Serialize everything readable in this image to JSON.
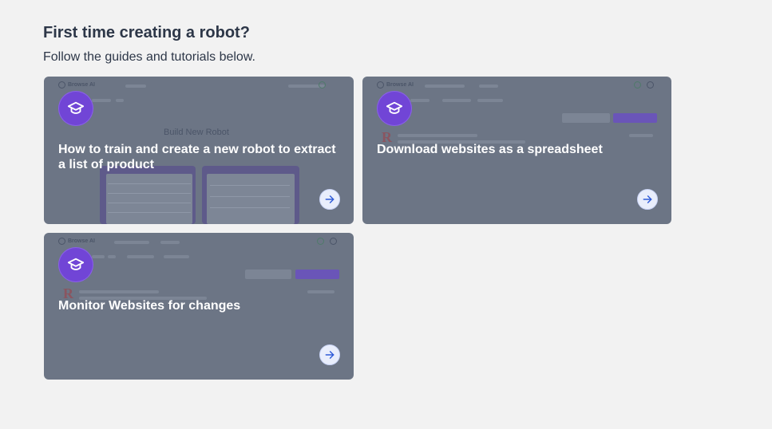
{
  "intro": {
    "title": "First time creating a robot?",
    "subtitle": "Follow the guides and tutorials below."
  },
  "cards": [
    {
      "title": "How to train and create a new robot to extract a list of product",
      "preview_brand": "Browse AI",
      "preview_heading": "Build New Robot",
      "badge_icon": "graduation-cap-icon",
      "action_icon": "arrow-right-icon"
    },
    {
      "title": "Download websites as a spreadsheet",
      "preview_brand": "Browse AI",
      "badge_icon": "graduation-cap-icon",
      "action_icon": "arrow-right-icon"
    },
    {
      "title": "Monitor Websites for changes",
      "preview_brand": "Browse AI",
      "badge_icon": "graduation-cap-icon",
      "action_icon": "arrow-right-icon"
    }
  ],
  "colors": {
    "page_bg": "#f2f2f2",
    "card_overlay": "#6c7585",
    "badge": "#7145d6",
    "arrow": "#2f5bd8"
  }
}
